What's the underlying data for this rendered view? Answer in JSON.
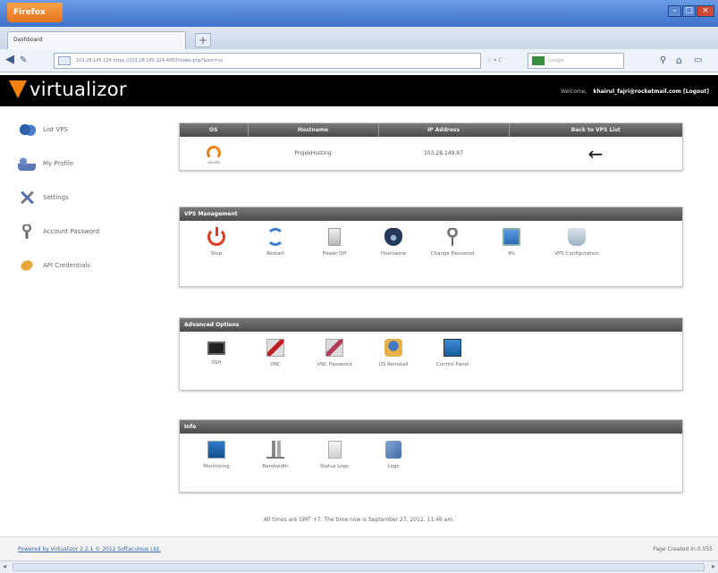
{
  "browser": {
    "app_button": "Firefox",
    "tab_title": "Dashboard",
    "new_tab": "+",
    "url": "103.28.145.124 https://103.28.145.124:4083/index.php?&act=vs",
    "search_placeholder": "Google"
  },
  "header": {
    "logo": "virtualizor",
    "welcome_label": "Welcome,",
    "user": "khairul_fajri@rocketmail.com",
    "logout": "[Logout]"
  },
  "sidebar": {
    "items": [
      {
        "label": "List VPS",
        "icon": "servers-icon"
      },
      {
        "label": "My Profile",
        "icon": "users-icon"
      },
      {
        "label": "Settings",
        "icon": "tools-icon"
      },
      {
        "label": "Account Password",
        "icon": "key-icon"
      },
      {
        "label": "API Credentials",
        "icon": "plug-icon"
      }
    ]
  },
  "vps_table": {
    "headers": [
      "OS",
      "Hostname",
      "IP Address",
      "Back to VPS List"
    ],
    "row": {
      "os_label": "ubuntu",
      "hostname": "ProjekHosting",
      "ip": "103.28.149.87",
      "back_icon": "←"
    }
  },
  "vps_management": {
    "title": "VPS Management",
    "items": [
      {
        "label": "Stop"
      },
      {
        "label": "Restart"
      },
      {
        "label": "Power Off"
      },
      {
        "label": "Hostname"
      },
      {
        "label": "Change Password"
      },
      {
        "label": "IPs"
      },
      {
        "label": "VPS Configuration"
      }
    ]
  },
  "advanced_options": {
    "title": "Advanced Options",
    "items": [
      {
        "label": "SSH"
      },
      {
        "label": "VNC"
      },
      {
        "label": "VNC Password"
      },
      {
        "label": "OS Reinstall"
      },
      {
        "label": "Control Panel"
      }
    ]
  },
  "info": {
    "title": "Info",
    "items": [
      {
        "label": "Monitoring"
      },
      {
        "label": "Bandwidth"
      },
      {
        "label": "Status Logs"
      },
      {
        "label": "Logs"
      }
    ]
  },
  "footer": {
    "timezone_note": "All times are GMT +7. The time now is September 27, 2012, 11:46 am.",
    "powered_by": "Powered by Virtualizor 2.2.1 © 2012 Softaculous Ltd.",
    "page_created": "Page Created In:0.055"
  }
}
